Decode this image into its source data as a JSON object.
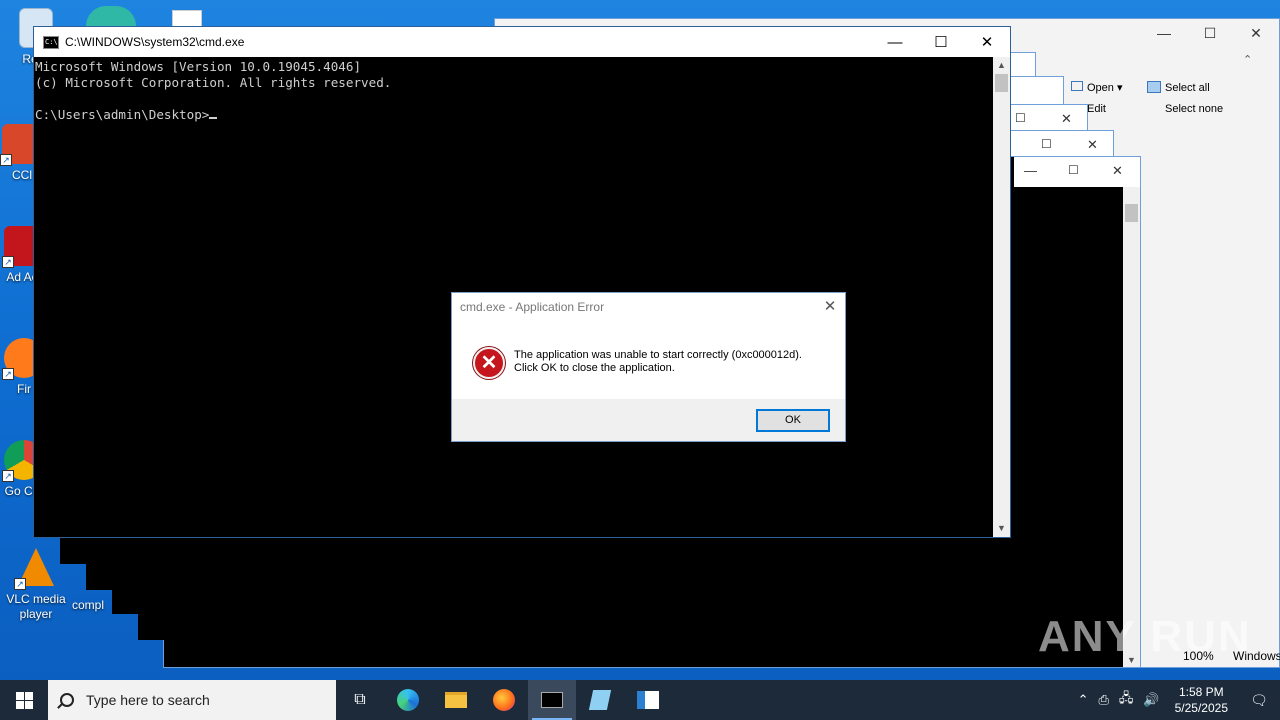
{
  "desktop": {
    "icons": [
      {
        "label": "Recy",
        "name": "recycle-bin"
      },
      {
        "label": "CCl",
        "name": "ccleaner"
      },
      {
        "label": "Ad Acr",
        "name": "adobe-acrobat"
      },
      {
        "label": "Fir",
        "name": "firefox"
      },
      {
        "label": "Go Chr",
        "name": "google-chrome"
      },
      {
        "label": "VLC media player",
        "name": "vlc"
      },
      {
        "label": "compl",
        "name": "compl-file"
      }
    ]
  },
  "explorer_window": {
    "ribbon": {
      "open_label": "Open",
      "edit_label": "Edit",
      "select_all_label": "Select all",
      "select_none_label": "Select none"
    },
    "status": {
      "zoom": "100%",
      "encoding": "Windows"
    }
  },
  "cmd_window": {
    "title": "C:\\WINDOWS\\system32\\cmd.exe",
    "lines": [
      "Microsoft Windows [Version 10.0.19045.4046]",
      "(c) Microsoft Corporation. All rights reserved.",
      "",
      "C:\\Users\\admin\\Desktop>"
    ]
  },
  "error_dialog": {
    "title": "cmd.exe - Application Error",
    "message_line1": "The application was unable to start correctly (0xc000012d).",
    "message_line2": "Click OK to close the application.",
    "ok_label": "OK"
  },
  "taskbar": {
    "search_placeholder": "Type here to search",
    "time": "1:58 PM",
    "date": "5/25/2025"
  },
  "watermark": "ANY RUN"
}
